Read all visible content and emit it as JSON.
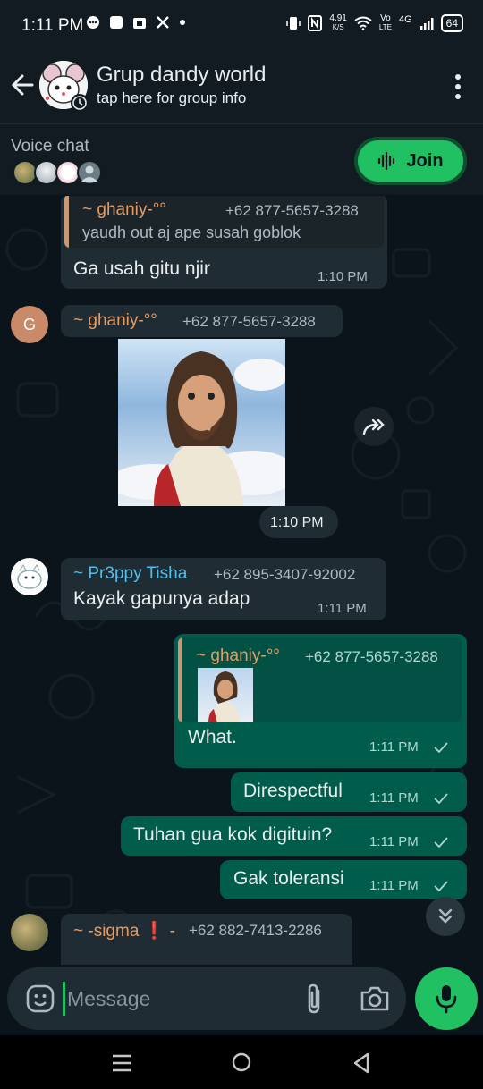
{
  "status_bar": {
    "time": "1:11 PM",
    "net_speed_value": "4.91",
    "net_speed_unit": "K/S",
    "volte_top": "Vo",
    "volte_bottom": "LTE",
    "network": "4G",
    "battery": "64"
  },
  "header": {
    "title": "Grup dandy world",
    "subtitle": "tap here for group info"
  },
  "voice_chat": {
    "label": "Voice chat",
    "join_label": "Join"
  },
  "messages": {
    "m1": {
      "quote_sender": "~ ghaniy-°°",
      "quote_phone": "+62 877-5657-3288",
      "quote_text": "yaudh out aj ape susah goblok",
      "text": "Ga usah gitu njir",
      "time": "1:10 PM"
    },
    "m2": {
      "avatar_letter": "G",
      "sender": "~ ghaniy-°°",
      "phone": "+62 877-5657-3288",
      "time": "1:10 PM"
    },
    "m3": {
      "sender": "~ Pr3ppy Tisha",
      "phone": "+62 895-3407-92002",
      "text": "Kayak gapunya adap",
      "time": "1:11 PM"
    },
    "m4": {
      "quote_sender": "~ ghaniy-°°",
      "quote_phone": "+62 877-5657-3288",
      "text": "What.",
      "time": "1:11 PM"
    },
    "m5": {
      "text": "Direspectful",
      "time": "1:11 PM"
    },
    "m6": {
      "text": "Tuhan gua kok digituin?",
      "time": "1:11 PM"
    },
    "m7": {
      "text": "Gak toleransi",
      "time": "1:11 PM"
    },
    "m8": {
      "sender": "~ -sigma",
      "sender_mark": "❗",
      "sender_suffix": "-",
      "phone": "+62 882-7413-2286"
    }
  },
  "composer": {
    "placeholder": "Message"
  },
  "colors": {
    "background": "#0b141a",
    "bar": "#111b21",
    "incoming_bubble": "#202c33",
    "outgoing_bubble": "#005c4b",
    "accent_green": "#21c063",
    "sender_orange": "#e59b63",
    "sender_blue": "#53bdeb"
  },
  "icons": [
    "back-arrow-icon",
    "more-vert-icon",
    "waveform-icon",
    "forward-icon",
    "double-chevron-down-icon",
    "emoji-icon",
    "attach-icon",
    "camera-icon",
    "mic-icon",
    "check-icon"
  ]
}
